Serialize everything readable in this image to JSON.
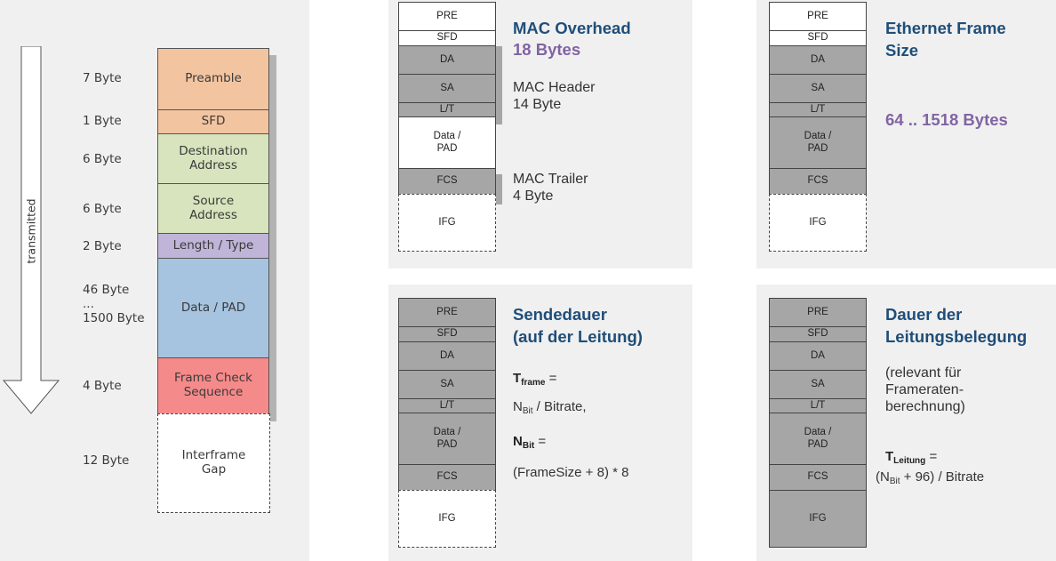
{
  "left": {
    "arrow_label": "transmitted",
    "fields": [
      {
        "bytes": "7 Byte",
        "label": "Preamble",
        "color": "#f2c4a0"
      },
      {
        "bytes": "1 Byte",
        "label": "SFD",
        "color": "#f2c4a0"
      },
      {
        "bytes": "6 Byte",
        "label": "Destination\nAddress",
        "color": "#d7e4bd"
      },
      {
        "bytes": "6 Byte",
        "label": "Source\nAddress",
        "color": "#d7e4bd"
      },
      {
        "bytes": "2 Byte",
        "label": "Length / Type",
        "color": "#c0b4d8"
      },
      {
        "bytes": "46 Byte\n...\n1500 Byte",
        "label": "Data / PAD",
        "color": "#a6c4e0"
      },
      {
        "bytes": "4 Byte",
        "label": "Frame Check\nSequence",
        "color": "#f58a8a"
      },
      {
        "bytes": "12 Byte",
        "label": "Interframe\nGap",
        "color": "#ffffff"
      }
    ]
  },
  "frame_cells": [
    "PRE",
    "SFD",
    "DA",
    "SA",
    "L/T",
    "Data /\nPAD",
    "FCS",
    "IFG"
  ],
  "panels": {
    "overhead": {
      "title": "MAC Overhead",
      "size": "18 Bytes",
      "header": "MAC Header\n14 Byte",
      "trailer": "MAC Trailer\n4 Byte"
    },
    "framesize": {
      "title": "Ethernet Frame\nSize",
      "range": "64 .. 1518 Bytes"
    },
    "sendedauer": {
      "title": "Sendedauer\n(auf der Leitung)",
      "t_frame": "T",
      "t_frame_sub": "frame",
      "eq1": " =",
      "n_bit": "N",
      "n_bit_sub": "Bit",
      "f1_rest": " / Bitrate,",
      "n_bit_b": "N",
      "n_bit_b_sub": "Bit",
      "eq2": " =",
      "f2": "(FrameSize + 8) * 8"
    },
    "belegung": {
      "title": "Dauer der\nLeitungsbelegung",
      "note": "(relevant für\nFrameraten-\nberechnung)",
      "t_leitung": "T",
      "t_leitung_sub": "Leitung",
      "eq": " =",
      "f_open": "(N",
      "f_sub": "Bit",
      "f_rest": " + 96) / Bitrate"
    }
  },
  "colors": {
    "title_blue": "#1f4e79",
    "accent_purple": "#8064a2",
    "panel_bg": "#f0f0f0",
    "cell_gray": "#a6a6a6"
  }
}
